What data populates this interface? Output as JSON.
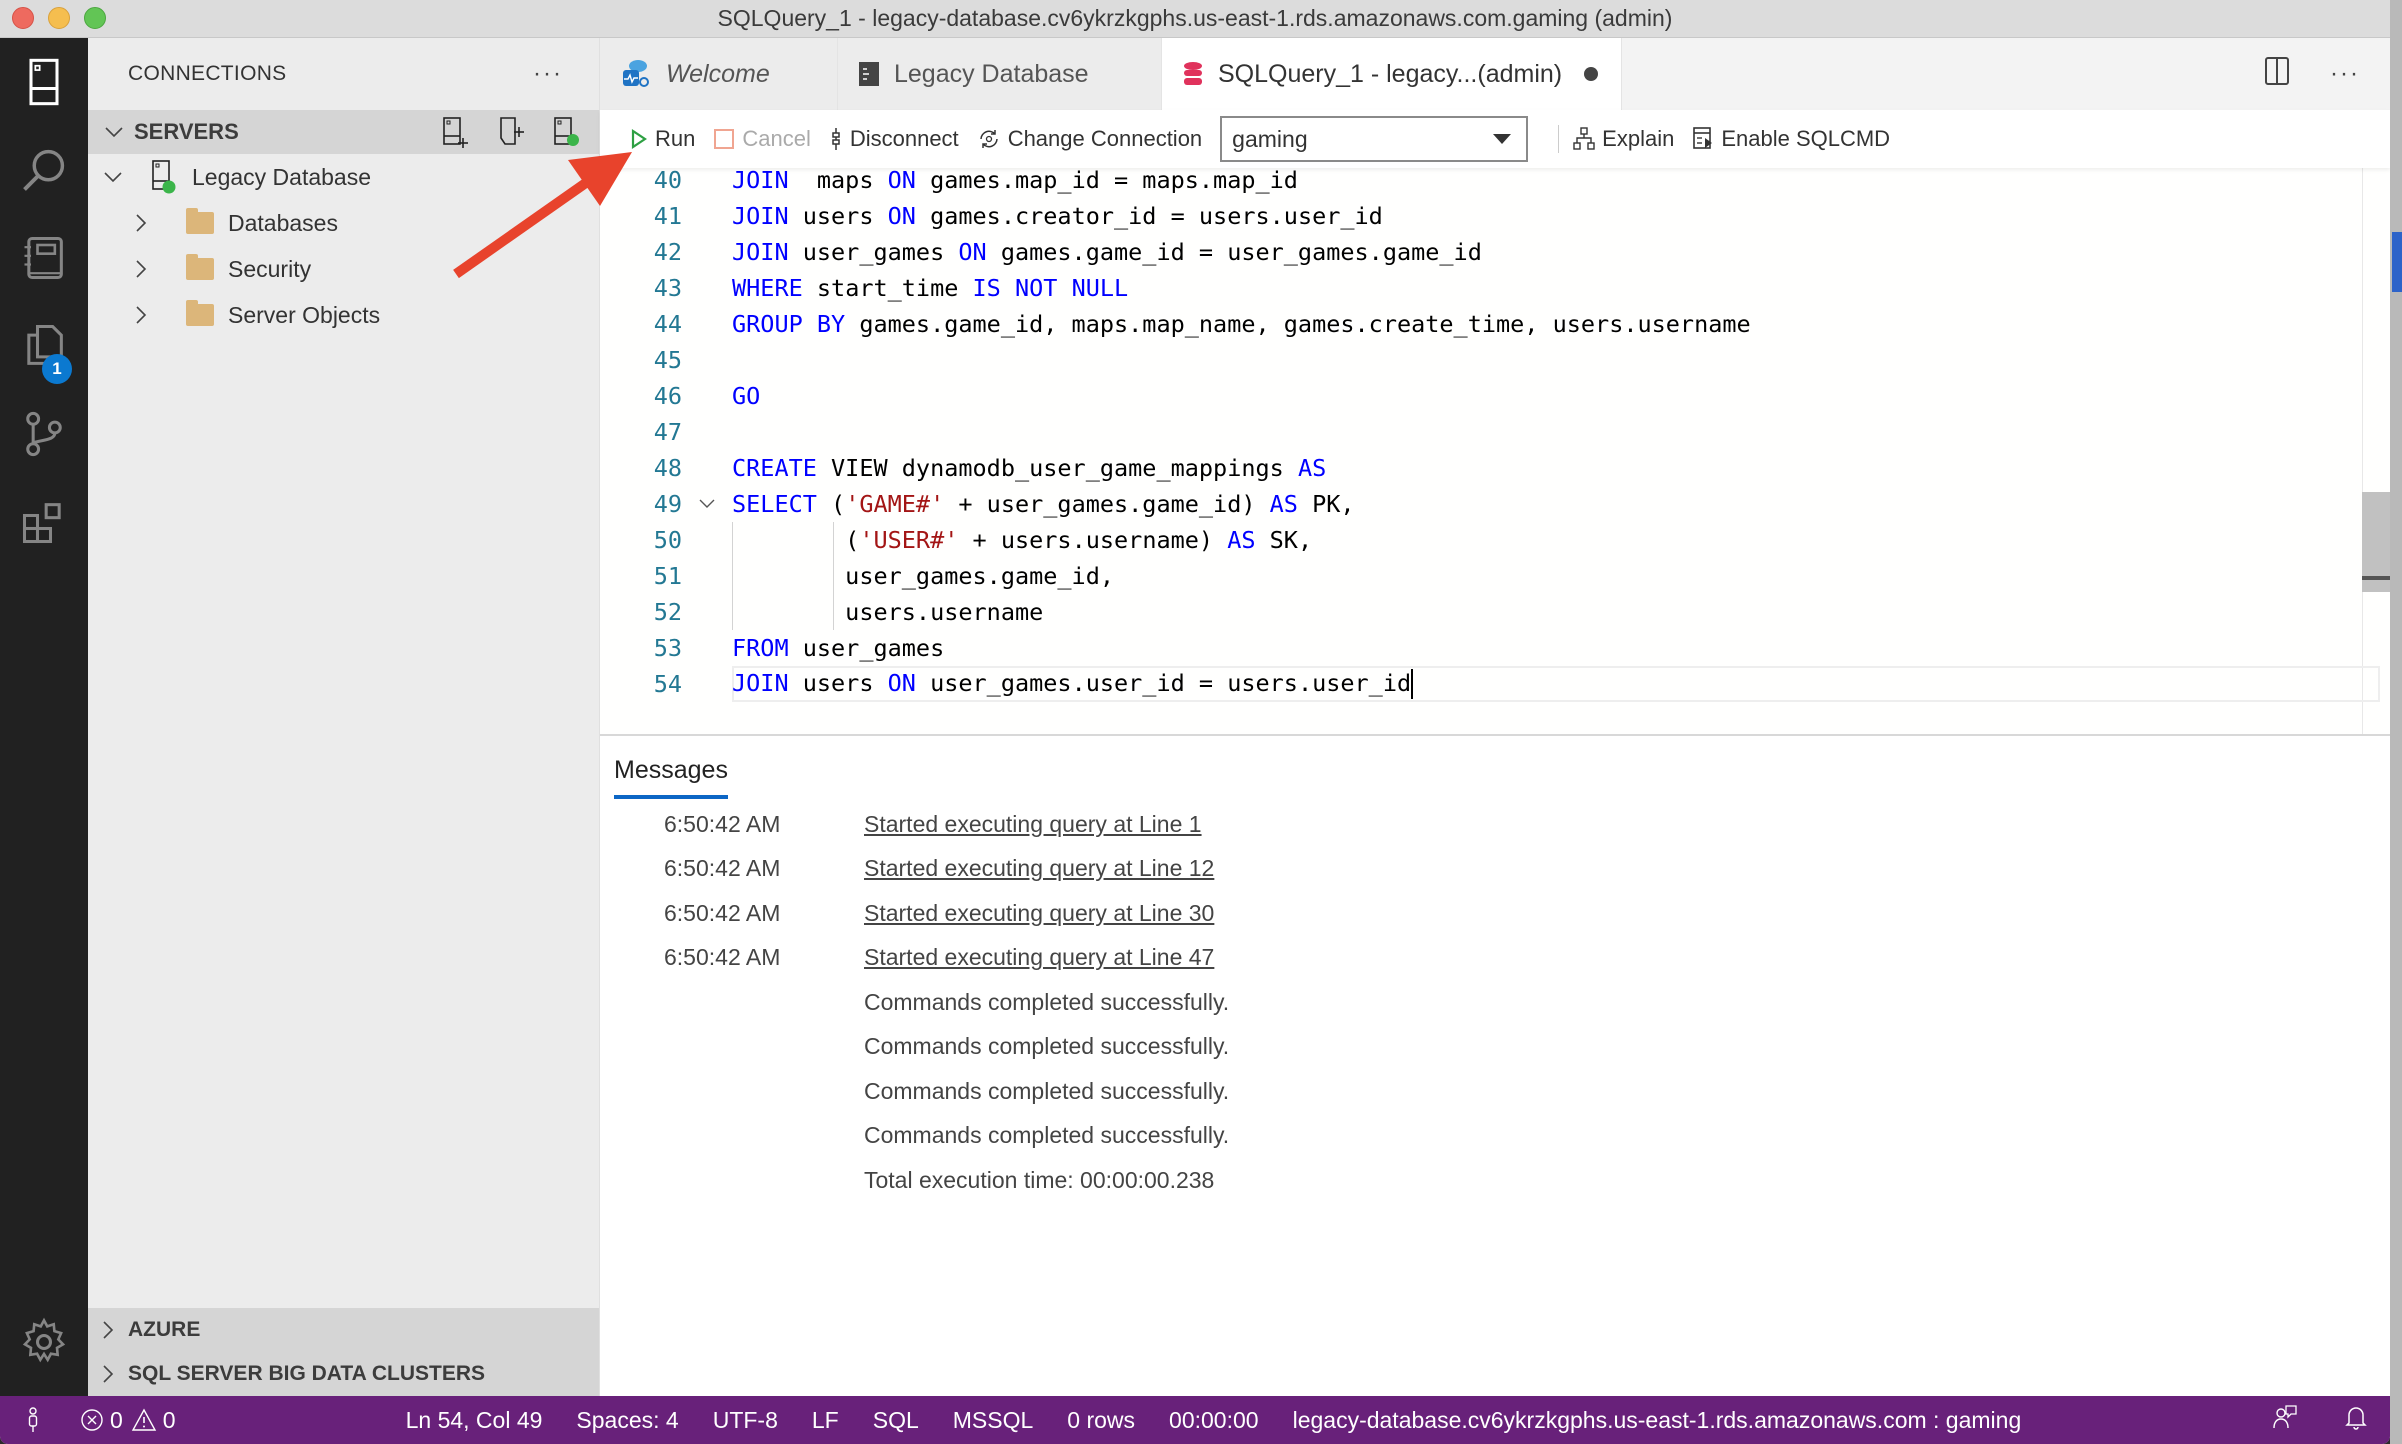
{
  "window": {
    "title": "SQLQuery_1 - legacy-database.cv6ykrzkgphs.us-east-1.rds.amazonaws.com.gaming (admin)"
  },
  "activity_bar": {
    "items": [
      {
        "name": "connections",
        "icon": "server-icon"
      },
      {
        "name": "search",
        "icon": "search-icon"
      },
      {
        "name": "notebooks",
        "icon": "notebook-icon"
      },
      {
        "name": "explorer",
        "icon": "files-icon",
        "badge": "1"
      },
      {
        "name": "source-control",
        "icon": "source-control-icon"
      },
      {
        "name": "extensions",
        "icon": "extensions-icon"
      }
    ],
    "settings_icon": "gear-icon"
  },
  "sidebar": {
    "header": "CONNECTIONS",
    "more_label": "···",
    "servers_section": "SERVERS",
    "server": {
      "name": "Legacy Database",
      "status_color": "#3bb54a",
      "children": [
        "Databases",
        "Security",
        "Server Objects"
      ]
    },
    "bottom_sections": [
      "AZURE",
      "SQL SERVER BIG DATA CLUSTERS"
    ]
  },
  "tabs": [
    {
      "label": "Welcome",
      "italic": true,
      "active": false
    },
    {
      "label": "Legacy Database",
      "active": false
    },
    {
      "label": "SQLQuery_1 - legacy...(admin)",
      "active": true,
      "dirty": true
    }
  ],
  "toolbar": {
    "run": "Run",
    "cancel": "Cancel",
    "disconnect": "Disconnect",
    "change_connection": "Change Connection",
    "database": "gaming",
    "explain": "Explain",
    "enable_sqlcmd": "Enable SQLCMD"
  },
  "editor": {
    "lines": [
      {
        "n": "40",
        "tokens": [
          [
            "kw",
            "JOIN"
          ],
          [
            "",
            "  maps "
          ],
          [
            "kw",
            "ON"
          ],
          [
            "",
            " games.map_id = maps.map_id"
          ]
        ]
      },
      {
        "n": "41",
        "tokens": [
          [
            "kw",
            "JOIN"
          ],
          [
            "",
            " users "
          ],
          [
            "kw",
            "ON"
          ],
          [
            "",
            " games.creator_id = users.user_id"
          ]
        ]
      },
      {
        "n": "42",
        "tokens": [
          [
            "kw",
            "JOIN"
          ],
          [
            "",
            " user_games "
          ],
          [
            "kw",
            "ON"
          ],
          [
            "",
            " games.game_id = user_games.game_id"
          ]
        ]
      },
      {
        "n": "43",
        "tokens": [
          [
            "kw",
            "WHERE"
          ],
          [
            "",
            " start_time "
          ],
          [
            "kw",
            "IS NOT NULL"
          ]
        ]
      },
      {
        "n": "44",
        "tokens": [
          [
            "kw",
            "GROUP BY"
          ],
          [
            "",
            " games.game_id, maps.map_name, games.create_time, users.username"
          ]
        ]
      },
      {
        "n": "45",
        "tokens": []
      },
      {
        "n": "46",
        "tokens": [
          [
            "kw",
            "GO"
          ]
        ]
      },
      {
        "n": "47",
        "tokens": []
      },
      {
        "n": "48",
        "tokens": [
          [
            "kw",
            "CREATE"
          ],
          [
            "",
            " VIEW dynamodb_user_game_mappings "
          ],
          [
            "kw",
            "AS"
          ]
        ]
      },
      {
        "n": "49",
        "fold": true,
        "tokens": [
          [
            "kw",
            "SELECT"
          ],
          [
            "",
            " ("
          ],
          [
            "str",
            "'GAME#'"
          ],
          [
            "",
            " + user_games.game_id) "
          ],
          [
            "kw",
            "AS"
          ],
          [
            "",
            " PK,"
          ]
        ]
      },
      {
        "n": "50",
        "tokens": [
          [
            "",
            "        ("
          ],
          [
            "str",
            "'USER#'"
          ],
          [
            "",
            " + users.username) "
          ],
          [
            "kw",
            "AS"
          ],
          [
            "",
            " SK,"
          ]
        ]
      },
      {
        "n": "51",
        "tokens": [
          [
            "",
            "        user_games.game_id,"
          ]
        ]
      },
      {
        "n": "52",
        "tokens": [
          [
            "",
            "        users.username"
          ]
        ]
      },
      {
        "n": "53",
        "tokens": [
          [
            "kw",
            "FROM"
          ],
          [
            "",
            " user_games"
          ]
        ]
      },
      {
        "n": "54",
        "current": true,
        "tokens": [
          [
            "kw",
            "JOIN"
          ],
          [
            "",
            " users "
          ],
          [
            "kw",
            "ON"
          ],
          [
            "",
            " user_games.user_id = users.user_id"
          ]
        ]
      }
    ]
  },
  "messages": {
    "tab": "Messages",
    "rows": [
      {
        "time": "6:50:42 AM",
        "text": "Started executing query at Line 1",
        "link": true
      },
      {
        "time": "6:50:42 AM",
        "text": "Started executing query at Line 12",
        "link": true
      },
      {
        "time": "6:50:42 AM",
        "text": "Started executing query at Line 30",
        "link": true
      },
      {
        "time": "6:50:42 AM",
        "text": "Started executing query at Line 47",
        "link": true
      },
      {
        "time": "",
        "text": "Commands completed successfully.",
        "link": false
      },
      {
        "time": "",
        "text": "Commands completed successfully.",
        "link": false
      },
      {
        "time": "",
        "text": "Commands completed successfully.",
        "link": false
      },
      {
        "time": "",
        "text": "Commands completed successfully.",
        "link": false
      },
      {
        "time": "",
        "text": "Total execution time: 00:00:00.238",
        "link": false
      }
    ]
  },
  "statusbar": {
    "errors": "0",
    "warnings": "0",
    "position": "Ln 54, Col 49",
    "spaces": "Spaces: 4",
    "encoding": "UTF-8",
    "eol": "LF",
    "language": "SQL",
    "provider": "MSSQL",
    "rows": "0 rows",
    "elapsed": "00:00:00",
    "connection": "legacy-database.cv6ykrzkgphs.us-east-1.rds.amazonaws.com : gaming",
    "color": "#68217a"
  }
}
